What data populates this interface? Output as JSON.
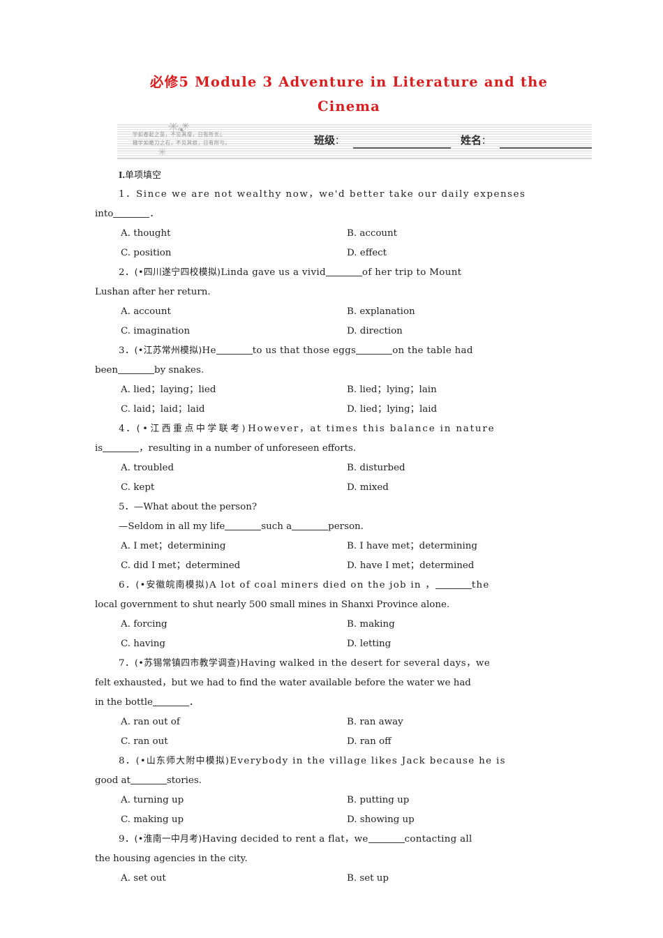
{
  "title": {
    "line1": "必修5  Module 3  Adventure in Literature and the",
    "line2": "Cinema",
    "color": "#d81e1e"
  },
  "header": {
    "watermark_line1": "学如春起之苗，不见其增，日有所长；",
    "watermark_line2": "辍学如磨刀之石，不见其损，日有所亏。",
    "class_label": "班级",
    "name_label": "姓名",
    "colon": "："
  },
  "section": {
    "number": "I.",
    "name": "单项填空"
  },
  "questions": [
    {
      "number": "1．",
      "source": "",
      "stem_lines": [
        "Since we are not wealthy now，we'd better take our daily expenses",
        "into"
      ],
      "tail": "．",
      "options": [
        {
          "key": "A.",
          "text": "thought"
        },
        {
          "key": "B.",
          "text": "account"
        },
        {
          "key": "C.",
          "text": "position"
        },
        {
          "key": "D.",
          "text": "effect"
        }
      ]
    },
    {
      "number": "2．",
      "source": "(•四川遂宁四校模拟)",
      "stem_lines": [
        "Linda gave us a vivid",
        "of her trip to Mount",
        "Lushan after her return."
      ],
      "options": [
        {
          "key": "A.",
          "text": "account"
        },
        {
          "key": "B.",
          "text": "explanation"
        },
        {
          "key": "C.",
          "text": "imagination"
        },
        {
          "key": "D.",
          "text": "direction"
        }
      ]
    },
    {
      "number": "3．",
      "source": "(•江苏常州模拟)",
      "stem_lines": [
        "He",
        "to us that those eggs",
        "on the table had",
        "been",
        "by snakes."
      ],
      "options": [
        {
          "key": "A.",
          "text": "lied；laying；lied"
        },
        {
          "key": "B.",
          "text": "lied；lying；lain"
        },
        {
          "key": "C.",
          "text": "laid；laid；laid"
        },
        {
          "key": "D.",
          "text": "lied；lying；laid"
        }
      ]
    },
    {
      "number": "4．",
      "source": "(•江西重点中学联考)",
      "stem_lines": [
        "However，at times this balance in nature",
        "is",
        "，resulting in a number of unforeseen efforts."
      ],
      "options": [
        {
          "key": "A.",
          "text": "troubled"
        },
        {
          "key": "B.",
          "text": "disturbed"
        },
        {
          "key": "C.",
          "text": "kept"
        },
        {
          "key": "D.",
          "text": "mixed"
        }
      ]
    },
    {
      "number": "5．",
      "source": "",
      "stem_lines": [
        "—What about the person?",
        "—Seldom in all my life",
        "such a",
        "person."
      ],
      "options": [
        {
          "key": "A.",
          "text": "I met；determining"
        },
        {
          "key": "B.",
          "text": "I have met；determining"
        },
        {
          "key": "C.",
          "text": "did I met；determined"
        },
        {
          "key": "D.",
          "text": "have I met；determined"
        }
      ]
    },
    {
      "number": "6．",
      "source": "(•安徽皖南模拟)",
      "stem_lines": [
        "A lot of coal miners died on the job in ，",
        "the",
        "local government to shut nearly 500 small mines in Shanxi Province alone."
      ],
      "options": [
        {
          "key": "A.",
          "text": "forcing"
        },
        {
          "key": "B.",
          "text": "making"
        },
        {
          "key": "C.",
          "text": "having"
        },
        {
          "key": "D.",
          "text": "letting"
        }
      ]
    },
    {
      "number": "7．",
      "source": "(•苏锡常镇四市教学调查)",
      "stem_lines": [
        "Having walked in the desert for several days，we",
        "felt exhausted，but we had to find the water available before the water we had",
        "in the bottle"
      ],
      "tail": "．",
      "options": [
        {
          "key": "A.",
          "text": "ran out of"
        },
        {
          "key": "B.",
          "text": "ran away"
        },
        {
          "key": "C.",
          "text": "ran out"
        },
        {
          "key": "D.",
          "text": "ran off"
        }
      ]
    },
    {
      "number": "8．",
      "source": "(•山东师大附中模拟)",
      "stem_lines": [
        "Everybody in the village likes Jack because he is",
        "good at",
        "stories."
      ],
      "options": [
        {
          "key": "A.",
          "text": "turning up"
        },
        {
          "key": "B.",
          "text": "putting up"
        },
        {
          "key": "C.",
          "text": "making up"
        },
        {
          "key": "D.",
          "text": "showing up"
        }
      ]
    },
    {
      "number": "9．",
      "source": "(•淮南一中月考)",
      "stem_lines": [
        "Having decided to rent a flat，we",
        "contacting all",
        "the housing agencies in the city."
      ],
      "options": [
        {
          "key": "A.",
          "text": "set out"
        },
        {
          "key": "B.",
          "text": "set up"
        }
      ]
    }
  ]
}
